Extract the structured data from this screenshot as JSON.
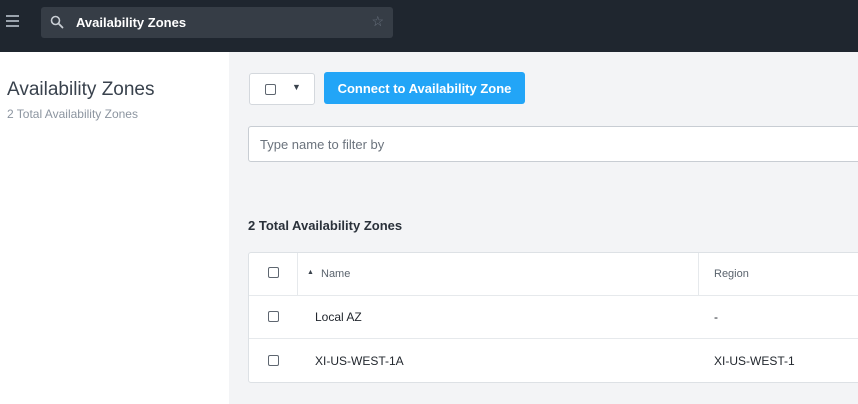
{
  "topbar": {
    "search_text": "Availability Zones",
    "icons": {
      "menu": "hamburger-menu-icon",
      "search": "search-icon",
      "favorite": "star-icon"
    }
  },
  "page": {
    "title": "Availability Zones",
    "subtitle": "2 Total Availability Zones"
  },
  "toolbar": {
    "connect_label": "Connect to Availability Zone",
    "filter_placeholder": "Type name to filter by"
  },
  "table": {
    "count_label": "2 Total Availability Zones",
    "columns": {
      "name": "Name",
      "region": "Region"
    },
    "sort": "ascending by Name",
    "rows": [
      {
        "name": "Local AZ",
        "region": "-"
      },
      {
        "name": "XI-US-WEST-1A",
        "region": "XI-US-WEST-1"
      }
    ]
  },
  "colors": {
    "topbar_bg": "#1f262f",
    "search_bg": "#363d46",
    "primary_button": "#22a5f7",
    "main_bg": "#f3f4f6"
  }
}
